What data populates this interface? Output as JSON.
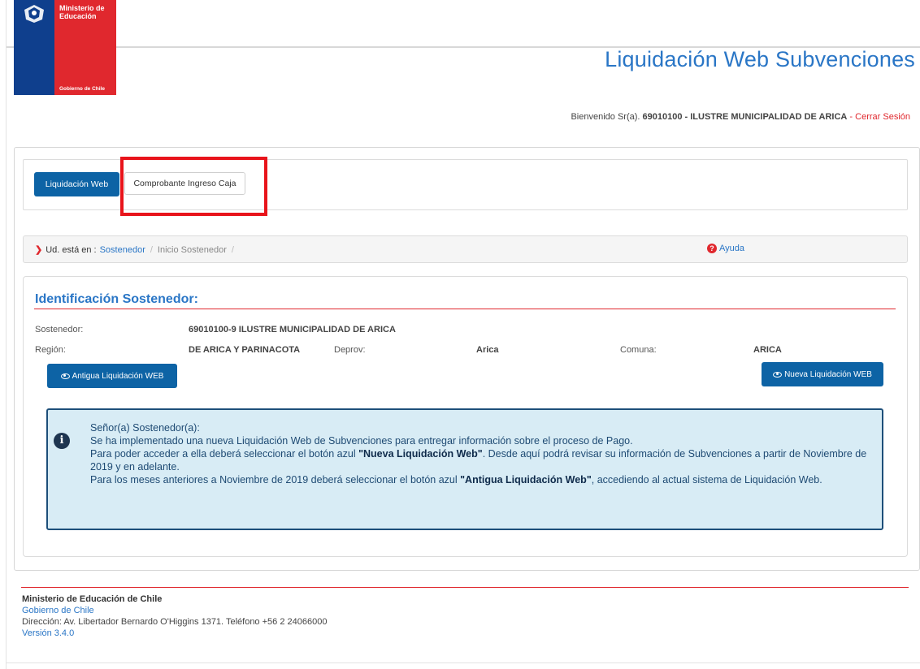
{
  "header": {
    "logo_line1": "Ministerio de",
    "logo_line2": "Educación",
    "logo_bottom": "Gobierno de Chile",
    "app_title": "Liquidación Web Subvenciones",
    "welcome_prefix": "Bienvenido Sr(a).",
    "welcome_user": "69010100 - ILUSTRE MUNICIPALIDAD DE ARICA",
    "welcome_sep": "-",
    "logout_label": "Cerrar Sesión"
  },
  "tabs": {
    "liquidacion_label": "Liquidación Web",
    "comprobante_label": "Comprobante Ingreso Caja"
  },
  "breadcrumb": {
    "prefix": "Ud. está en :",
    "items": [
      "Sostenedor",
      "Inicio Sostenedor"
    ],
    "sep": "/",
    "help_label": "Ayuda"
  },
  "identificacion": {
    "title": "Identificación Sostenedor:",
    "sostenedor_label": "Sostenedor:",
    "sostenedor_value": "69010100-9 ILUSTRE MUNICIPALIDAD DE ARICA",
    "region_label": "Región:",
    "region_value": "DE ARICA Y PARINACOTA",
    "deprov_label": "Deprov:",
    "deprov_value": "Arica",
    "comuna_label": "Comuna:",
    "comuna_value": "ARICA",
    "btn_antigua": "Antigua Liquidación WEB",
    "btn_nueva": "Nueva Liquidación WEB"
  },
  "info": {
    "line1": "Señor(a) Sostenedor(a):",
    "line2": "Se ha implementado una nueva Liquidación Web de Subvenciones para entregar información sobre el proceso de Pago.",
    "line3_a": "Para poder acceder a ella deberá seleccionar el botón azul ",
    "line3_b": "\"Nueva Liquidación Web\"",
    "line3_c": ". Desde aquí podrá revisar su información de Subvenciones a partir de Noviembre de 2019 y en adelante.",
    "line4_a": "Para los meses anteriores a Noviembre de 2019 deberá seleccionar el botón azul ",
    "line4_b": "\"Antigua Liquidación Web\"",
    "line4_c": ", accediendo al actual sistema de Liquidación Web."
  },
  "footer": {
    "org": "Ministerio de Educación de Chile",
    "gov": "Gobierno de Chile",
    "address": "Dirección: Av. Libertador Bernardo O'Higgins 1371. Teléfono +56 2 24066000",
    "version": "Versión 3.4.0"
  },
  "colors": {
    "brand_blue": "#0d63a5",
    "title_blue": "#2a76c6",
    "brand_red": "#e0282e",
    "info_bg": "#d8ecf5"
  }
}
